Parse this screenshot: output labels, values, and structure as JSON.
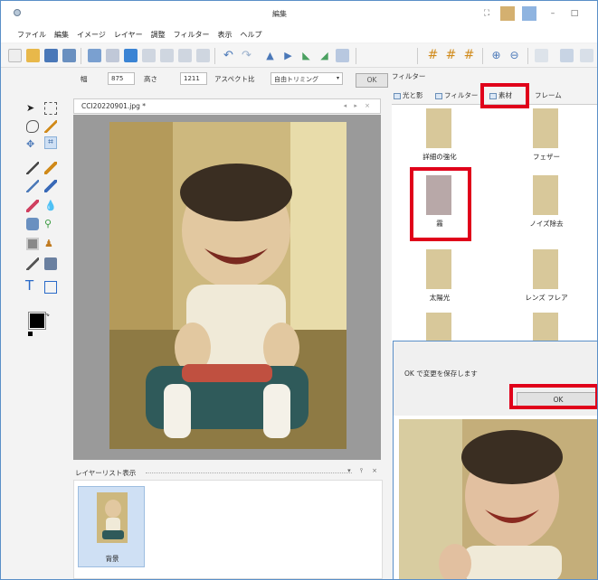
{
  "window": {
    "title": "編集"
  },
  "menu": [
    "ファイル",
    "編集",
    "イメージ",
    "レイヤー",
    "調整",
    "フィルター",
    "表示",
    "ヘルプ"
  ],
  "options": {
    "width_label": "幅",
    "width_value": "875",
    "height_label": "高さ",
    "height_value": "1211",
    "aspect_label": "アスペクト比",
    "trim_mode": "自由トリミング",
    "ok_label": "OK"
  },
  "document": {
    "tab_name": "CCI20220901.jpg *",
    "tab_controls": "◂ ▸ ×"
  },
  "layers": {
    "title": "レイヤーリスト表示",
    "controls": "▾ ⫯ ×",
    "items": [
      {
        "label": "背景"
      }
    ]
  },
  "filter_panel": {
    "title": "フィルター",
    "tabs": [
      "光と影",
      "フィルター",
      "素材",
      "フレーム"
    ],
    "items": [
      "詳細の強化",
      "フェザー",
      "霧",
      "ノイズ除去",
      "太陽光",
      "レンズ フレア"
    ]
  },
  "dialog": {
    "message": "OK で変更を保存します",
    "ok_label": "OK"
  },
  "colors": {
    "highlight": "#e0001a",
    "accent": "#5a8fc8"
  }
}
